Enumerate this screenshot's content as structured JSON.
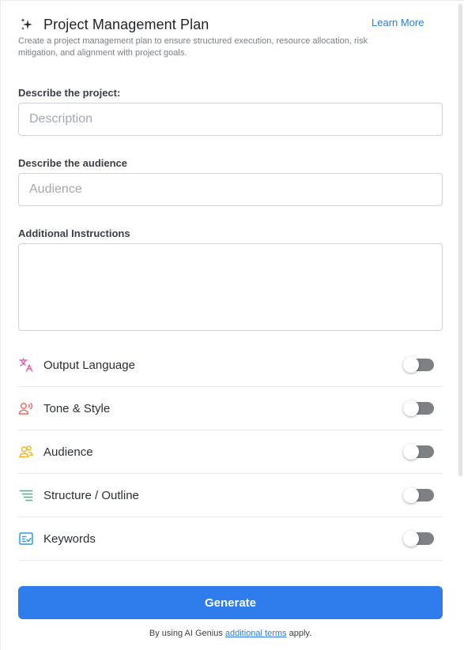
{
  "header": {
    "title": "Project Management Plan",
    "subtitle": "Create a project management plan to ensure structured execution, resource allocation, risk mitigation, and alignment with project goals.",
    "learn_more": "Learn More",
    "icon": "sparkle-icon"
  },
  "fields": {
    "project": {
      "label": "Describe the project:",
      "placeholder": "Description",
      "value": ""
    },
    "audience": {
      "label": "Describe the audience",
      "placeholder": "Audience",
      "value": ""
    },
    "instructions": {
      "label": "Additional Instructions",
      "value": ""
    }
  },
  "options": [
    {
      "label": "Output Language",
      "icon": "translate-icon",
      "color": "#e55ab4",
      "enabled": false
    },
    {
      "label": "Tone & Style",
      "icon": "voice-person-icon",
      "color": "#ef6a5f",
      "enabled": false
    },
    {
      "label": "Audience",
      "icon": "users-icon",
      "color": "#f0b429",
      "enabled": false
    },
    {
      "label": "Structure / Outline",
      "icon": "list-outline-icon",
      "color": "#2fbf7a",
      "enabled": false
    },
    {
      "label": "Keywords",
      "icon": "keyword-checklist-icon",
      "color": "#2d9ad9",
      "enabled": false
    }
  ],
  "generate_label": "Generate",
  "footer": {
    "prefix": "By using AI Genius ",
    "link": "additional terms",
    "suffix": " apply."
  },
  "colors": {
    "accent": "#2f7cec",
    "link": "#2d7be5",
    "toggle_off": "#7d8084"
  }
}
